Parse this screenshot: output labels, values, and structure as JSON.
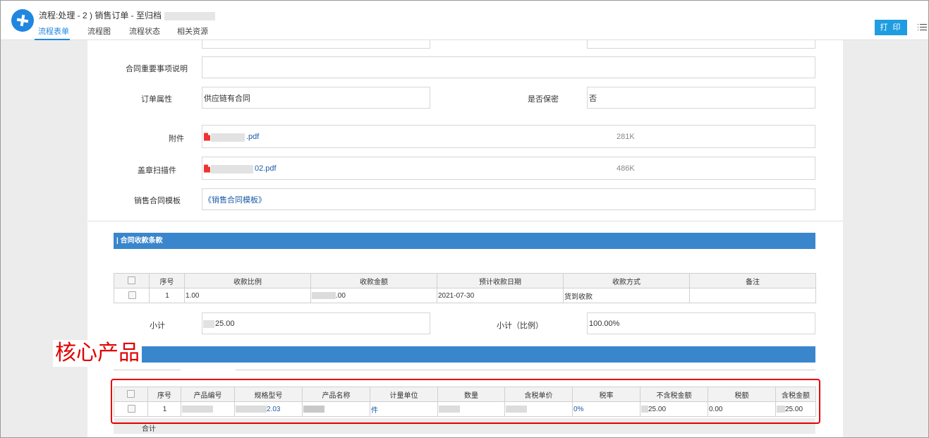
{
  "header": {
    "title": "流程:处理 - 2 ) 销售订单 - 至归档",
    "tabs": [
      {
        "label": "流程表单"
      },
      {
        "label": "流程图"
      },
      {
        "label": "流程状态"
      },
      {
        "label": "相关资源"
      }
    ],
    "print_label": "打 印"
  },
  "form": {
    "contract_note_label": "合同重要事项说明",
    "contract_note_value": "",
    "order_attr_label": "订单属性",
    "order_attr_value": "供应链有合同",
    "confidential_label": "是否保密",
    "confidential_value": "否",
    "attachment_label": "附件",
    "attachment_file": ".pdf",
    "attachment_size": "281K",
    "seal_scan_label": "盖章扫描件",
    "seal_scan_file": "02.pdf",
    "seal_scan_size": "486K",
    "template_label": "销售合同模板",
    "template_value": "《销售合同模板》"
  },
  "payment_section": {
    "title": "合同收款条款",
    "columns": [
      "序号",
      "收款比例",
      "收款金额",
      "预计收款日期",
      "收款方式",
      "备注"
    ],
    "rows": [
      {
        "index": "1",
        "ratio": "1.00",
        "amount": ".00",
        "date": "2021-07-30",
        "method": "货到收款",
        "note": ""
      }
    ],
    "subtotal_label": "小计",
    "subtotal_value": "25.00",
    "subtotal_ratio_label": "小计（比例）",
    "subtotal_ratio_value": "100.00%"
  },
  "product_section": {
    "annotation": "核心产品",
    "columns": [
      "序号",
      "产品编号",
      "规格型号",
      "产品名称",
      "计量单位",
      "数量",
      "含税单价",
      "税率",
      "不含税金额",
      "税额",
      "含税金额"
    ],
    "rows": [
      {
        "index": "1",
        "code": "",
        "spec": "2.03",
        "name": "",
        "unit": "件",
        "qty": "",
        "price": "",
        "tax_rate": "0%",
        "ex_tax": "25.00",
        "tax": "0.00",
        "inc_tax": "25.00"
      }
    ],
    "total_label": "合计"
  },
  "colors": {
    "accent": "#1f87e0",
    "section_bar": "#3a86cc",
    "annotation": "#e00000"
  }
}
